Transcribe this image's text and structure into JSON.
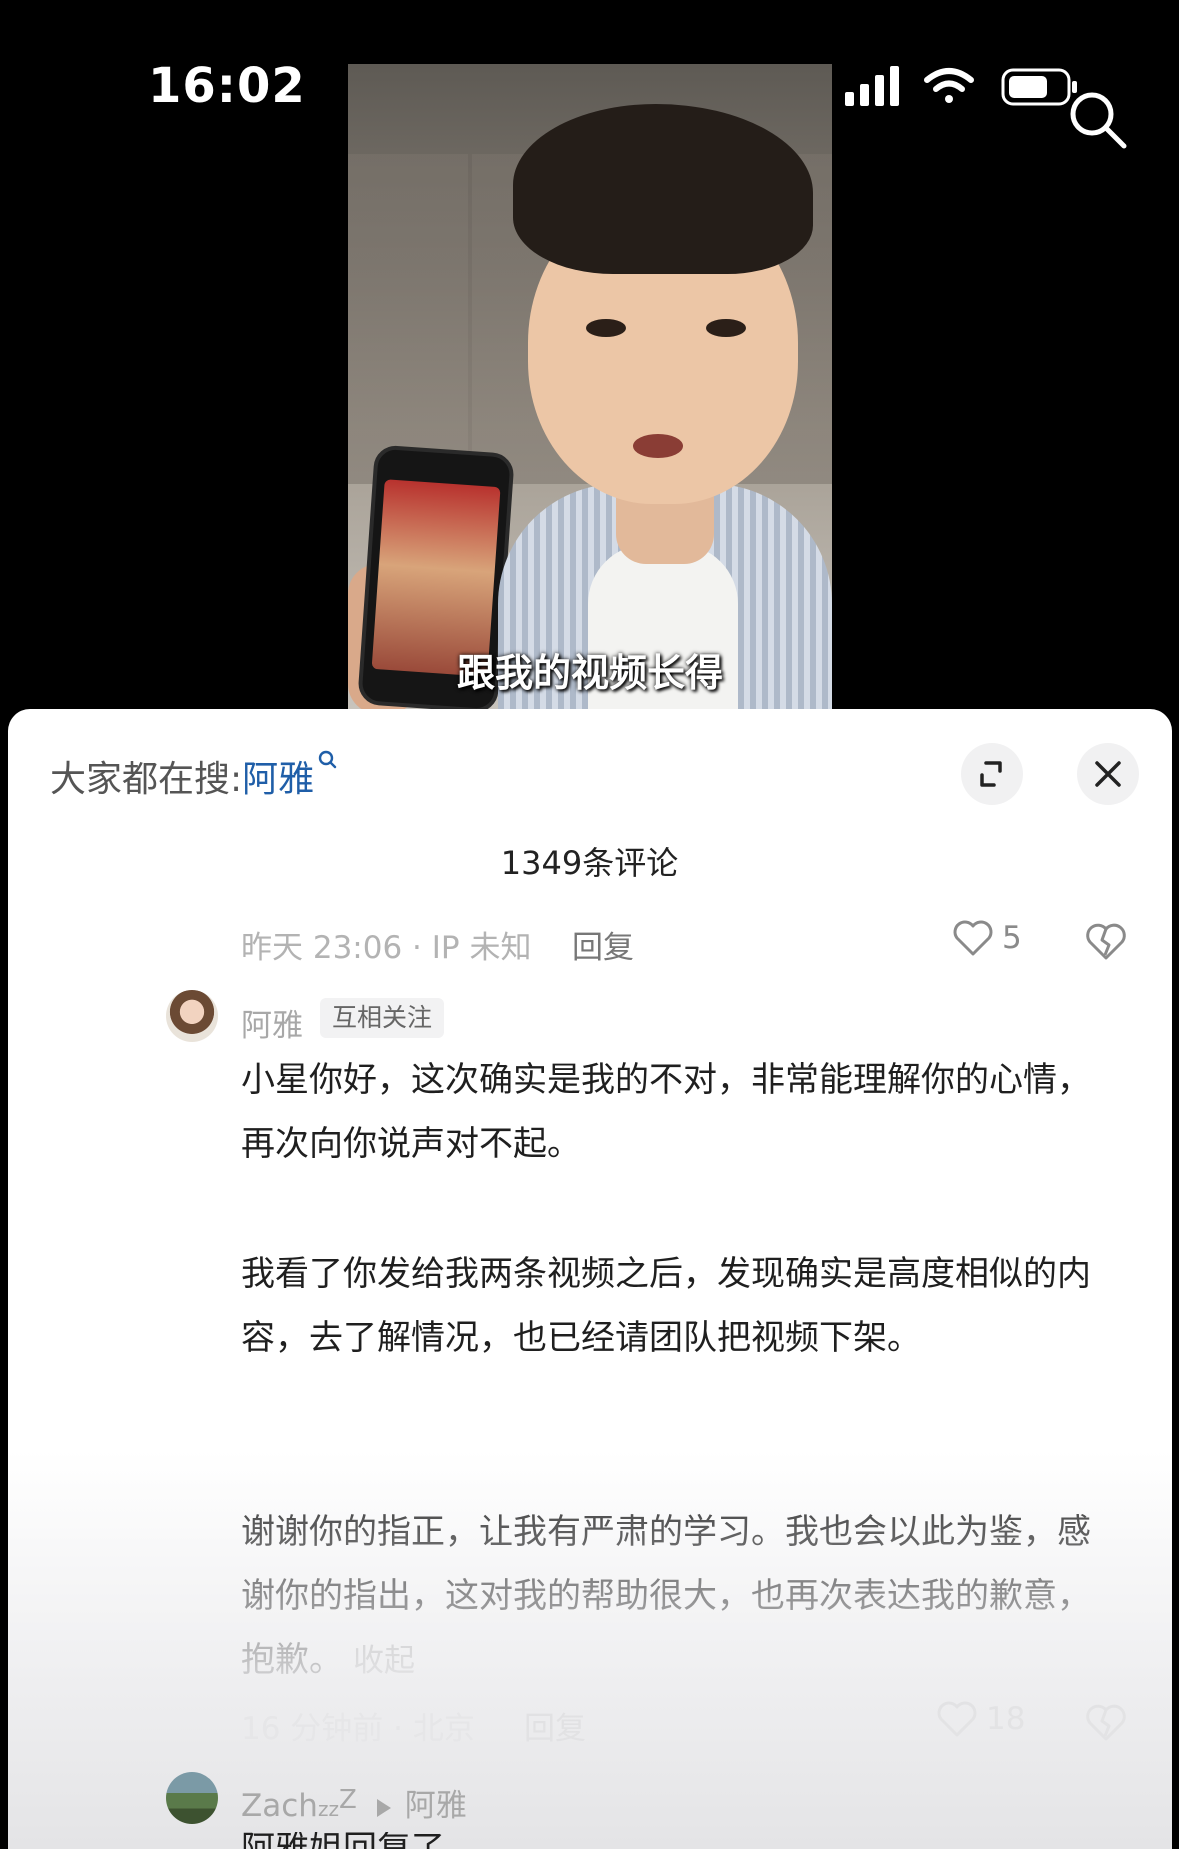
{
  "status_bar": {
    "time": "16:02"
  },
  "video": {
    "subtitle": "跟我的视频长得"
  },
  "sheet": {
    "search_prefix": "大家都在搜:",
    "search_keyword": "阿雅",
    "comment_count_title": "1349条评论"
  },
  "prev_comment": {
    "meta": "昨天 23:06 · IP 未知",
    "reply": "回复",
    "likes": "5"
  },
  "comment": {
    "username": "阿雅",
    "badge": "互相关注",
    "paragraphs": [
      "小星你好，这次确实是我的不对，非常能理解你的心情，再次向你说声对不起。",
      "我看了你发给我两条视频之后，发现确实是高度相似的内容，去了解情况，也已经请团队把视频下架。",
      "谢谢你的指正，让我有严肃的学习。我也会以此为鉴，感谢你的指出，这对我的帮助很大，也再次表达我的歉意，抱歉。"
    ],
    "collapse_label": "收起",
    "meta": "16 分钟前 · 北京",
    "reply": "回复",
    "likes": "18"
  },
  "reply_comment": {
    "username": "Zach",
    "username_suffix_small": "z",
    "username_suffix_mid": "z",
    "username_suffix_big": "Z",
    "reply_to": "阿雅",
    "text_partial": "阿雅姐回复了"
  },
  "colors": {
    "keyword": "#1f5ea8",
    "sheet_bg": "#ffffff",
    "screen_bg": "#000000"
  }
}
